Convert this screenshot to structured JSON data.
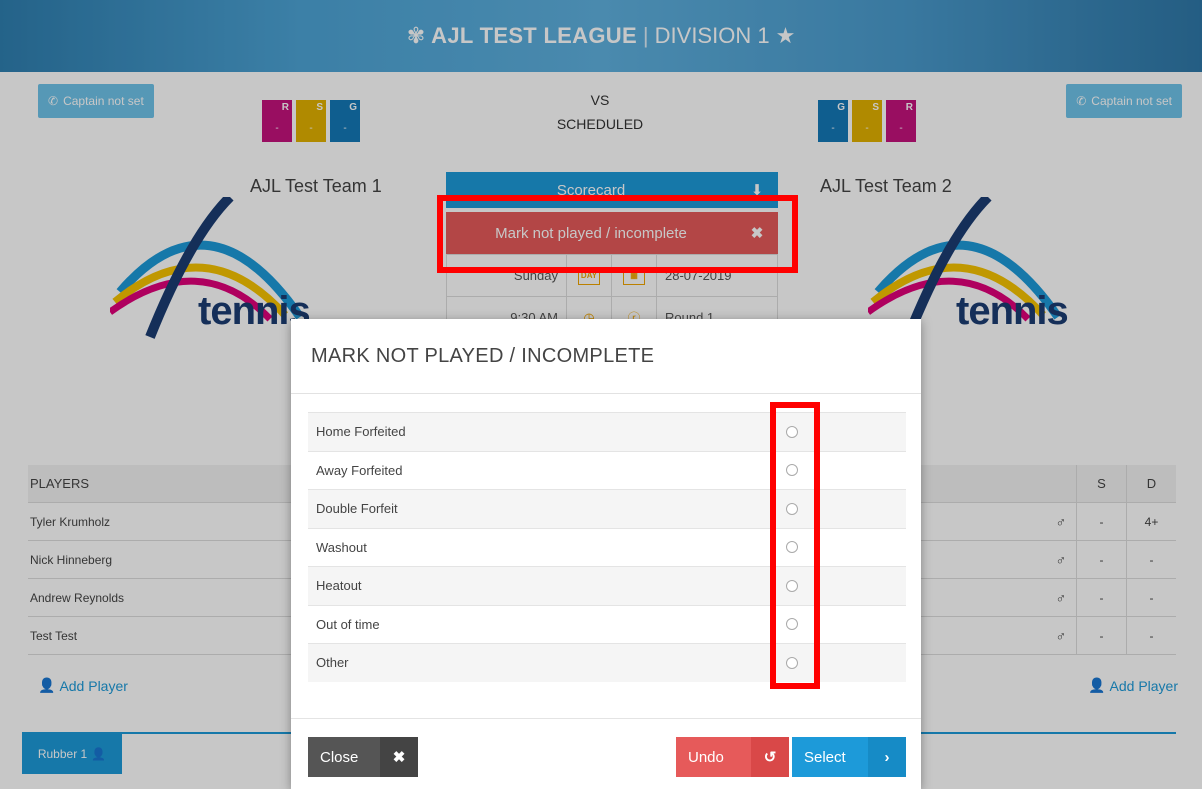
{
  "header": {
    "league": "AJL TEST LEAGUE",
    "separator": "|",
    "division": "DIVISION 1"
  },
  "home": {
    "captain_label": "Captain not set",
    "team_name": "AJL Test Team 1",
    "scores": [
      {
        "key": "R",
        "value": "-",
        "color": "#c4127d"
      },
      {
        "key": "S",
        "value": "-",
        "color": "#e2b100"
      },
      {
        "key": "G",
        "value": "-",
        "color": "#1479b8"
      }
    ],
    "add_player_label": "Add Player"
  },
  "away": {
    "captain_label": "Captain not set",
    "team_name": "AJL Test Team 2",
    "scores": [
      {
        "key": "G",
        "value": "-",
        "color": "#1479b8"
      },
      {
        "key": "S",
        "value": "-",
        "color": "#e2b100"
      },
      {
        "key": "R",
        "value": "-",
        "color": "#c4127d"
      }
    ],
    "add_player_label": "Add Player"
  },
  "match": {
    "vs": "VS",
    "status": "SCHEDULED",
    "scorecard_label": "Scorecard",
    "mark_label": "Mark not played / incomplete",
    "day": "Sunday",
    "day_icon_text": "DAY",
    "date": "28-07-2019",
    "time": "9:30 AM",
    "round": "Round 1"
  },
  "logo_word": "tennis",
  "players": {
    "header": "PLAYERS",
    "col_s": "S",
    "col_d": "D",
    "rows": [
      {
        "name": "Tyler Krumholz",
        "gender": "♂",
        "s": "-",
        "d": "4+"
      },
      {
        "name": "Nick Hinneberg",
        "gender": "♂",
        "s": "-",
        "d": "-"
      },
      {
        "name": "Andrew Reynolds",
        "gender": "♂",
        "s": "-",
        "d": "-"
      },
      {
        "name": "Test Test",
        "gender": "♂",
        "s": "-",
        "d": "-"
      }
    ]
  },
  "rubber_label": "Rubber 1",
  "modal": {
    "title": "MARK NOT PLAYED / INCOMPLETE",
    "options": [
      "Home Forfeited",
      "Away Forfeited",
      "Double Forfeit",
      "Washout",
      "Heatout",
      "Out of time",
      "Other"
    ],
    "close_label": "Close",
    "undo_label": "Undo",
    "select_label": "Select"
  }
}
